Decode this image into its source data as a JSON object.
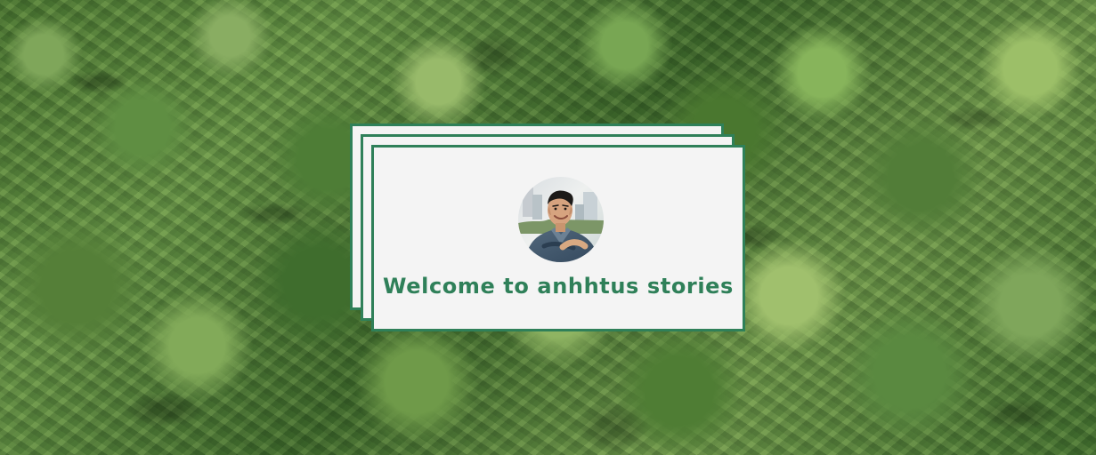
{
  "hero": {
    "background": "forest-treetops",
    "colors": {
      "card_border": "#2f8059",
      "card_background": "#f4f4f4",
      "title": "#2f8059"
    }
  },
  "card": {
    "avatar": "profile-photo",
    "title": "Welcome to anhhtus stories"
  }
}
